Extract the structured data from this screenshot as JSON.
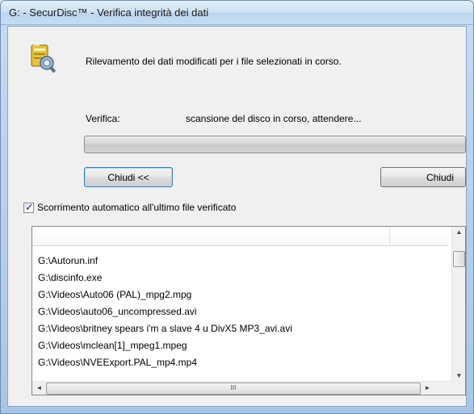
{
  "window": {
    "title": "G: - SecurDisc™ - Verifica integrità dei dati"
  },
  "main": {
    "message": "Rilevamento dei dati modificati per i file selezionati in corso.",
    "verify_label": "Verifica:",
    "verify_status": "scansione del disco in corso, attendere...",
    "progress_percent": 0
  },
  "buttons": {
    "toggle_label": "Chiudi <<",
    "close_label": "Chiudi"
  },
  "options": {
    "autoscroll_label": "Scorrimento automatico all'ultimo file verificato",
    "autoscroll_checked": true
  },
  "file_list": {
    "rows": [
      "G:\\Autorun.inf",
      "G:\\discinfo.exe",
      "G:\\Videos\\Auto06 (PAL)_mpg2.mpg",
      "G:\\Videos\\auto06_uncompressed.avi",
      "G:\\Videos\\britney spears i'm a slave 4 u DivX5 MP3_avi.avi",
      "G:\\Videos\\mclean[1]_mpeg1.mpeg",
      "G:\\Videos\\NVEExport.PAL_mp4.mp4"
    ]
  },
  "icons": {
    "app": "securdisc-verify-icon",
    "scroll_up": "▲",
    "scroll_down": "▼",
    "scroll_left": "◄",
    "scroll_right": "►",
    "grip": "III"
  }
}
